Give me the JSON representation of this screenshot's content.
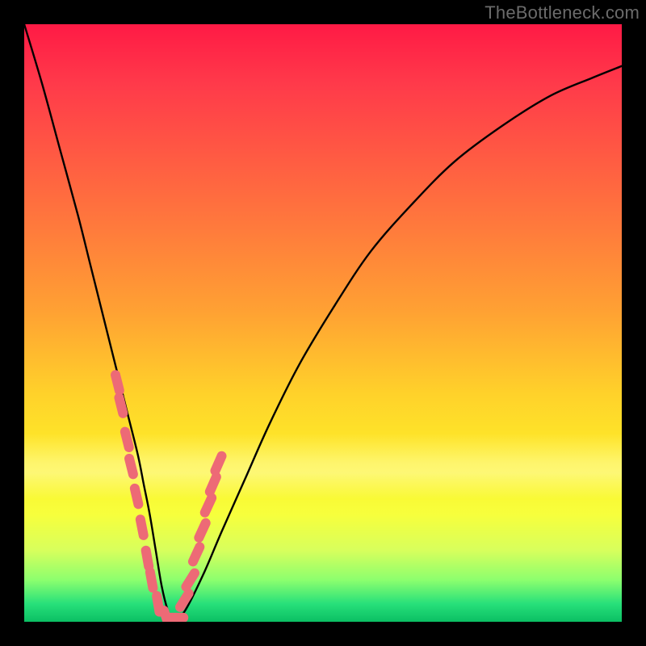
{
  "watermark": "TheBottleneck.com",
  "chart_data": {
    "type": "line",
    "title": "",
    "xlabel": "",
    "ylabel": "",
    "xlim": [
      0,
      100
    ],
    "ylim": [
      0,
      100
    ],
    "series": [
      {
        "name": "bottleneck-curve",
        "x": [
          0,
          3,
          6,
          9,
          11,
          13,
          15,
          17,
          19,
          20,
          21,
          22,
          23,
          24,
          25,
          27,
          30,
          33,
          37,
          41,
          46,
          52,
          58,
          65,
          72,
          80,
          88,
          95,
          100
        ],
        "values": [
          100,
          90,
          79,
          68,
          60,
          52,
          44,
          36,
          28,
          23,
          18,
          12,
          6,
          2,
          0,
          2,
          8,
          15,
          24,
          33,
          43,
          53,
          62,
          70,
          77,
          83,
          88,
          91,
          93
        ]
      }
    ],
    "markers": {
      "name": "highlight-points",
      "color": "#ed6a76",
      "points_flat": [
        15.6,
        40.0,
        16.2,
        36.2,
        17.2,
        30.5,
        17.9,
        26.0,
        18.8,
        21.0,
        19.7,
        15.8,
        20.6,
        10.6,
        21.3,
        7.0,
        22.4,
        3.0,
        23.8,
        0.6,
        25.3,
        0.7,
        26.8,
        3.6,
        27.8,
        7.0,
        28.8,
        11.3,
        29.8,
        15.3,
        30.8,
        19.5,
        31.6,
        23.0,
        32.5,
        26.5
      ]
    }
  }
}
